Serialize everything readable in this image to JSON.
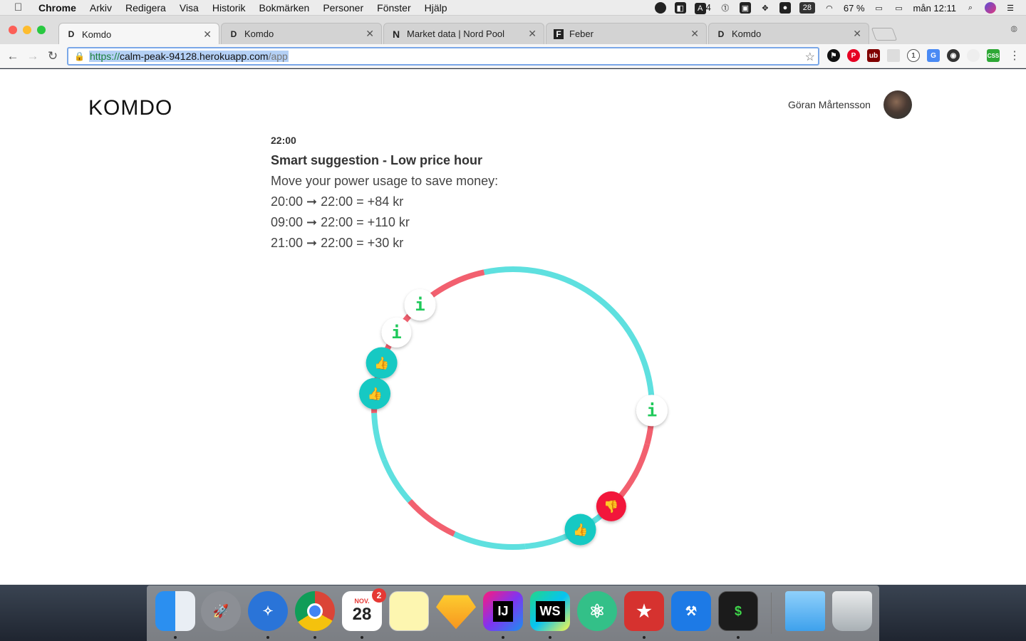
{
  "menubar": {
    "apple_icon": "apple-icon",
    "items": [
      "Chrome",
      "Arkiv",
      "Redigera",
      "Visa",
      "Historik",
      "Bokmärken",
      "Personer",
      "Fönster",
      "Hjälp"
    ],
    "status": {
      "adobe_count": "4",
      "calendar_day": "28",
      "battery": "67 %",
      "clock": "mån 12:11"
    }
  },
  "tabs": [
    {
      "title": "Komdo",
      "favicon": "D"
    },
    {
      "title": "Komdo",
      "favicon": "D"
    },
    {
      "title": "Market data | Nord Pool",
      "favicon": "N"
    },
    {
      "title": "Feber",
      "favicon": "F"
    },
    {
      "title": "Komdo",
      "favicon": "D"
    }
  ],
  "omnibox": {
    "scheme": "https://",
    "host": "calm-peak-94128.herokuapp.com",
    "path": "/app"
  },
  "header": {
    "logo": "KOMDO",
    "user_name": "Göran Mårtensson"
  },
  "suggestion": {
    "time": "22:00",
    "title": "Smart suggestion - Low price hour",
    "subtitle": "Move your power usage to save money:",
    "lines": [
      "20:00 ➞ 22:00 = +84 kr",
      "09:00 ➞ 22:00 = +110 kr",
      "21:00 ➞ 22:00 = +30 kr"
    ]
  },
  "ring": {
    "colors": {
      "cheap": "#5ee0df",
      "expensive": "#f2606f",
      "good": "#13c9c3",
      "bad": "#f2173a",
      "info": "#1fc95a"
    },
    "markers": [
      {
        "type": "info",
        "symbol": "i"
      },
      {
        "type": "info",
        "symbol": "i"
      },
      {
        "type": "good",
        "symbol": "👍"
      },
      {
        "type": "good",
        "symbol": "👍"
      },
      {
        "type": "info",
        "symbol": "i"
      },
      {
        "type": "bad",
        "symbol": "👎"
      },
      {
        "type": "good",
        "symbol": "👍"
      }
    ]
  },
  "dock": {
    "calendar_month": "NOV.",
    "calendar_day": "28",
    "calendar_badge": "2",
    "intellij": "IJ",
    "webstorm": "WS",
    "terminal": "$"
  }
}
